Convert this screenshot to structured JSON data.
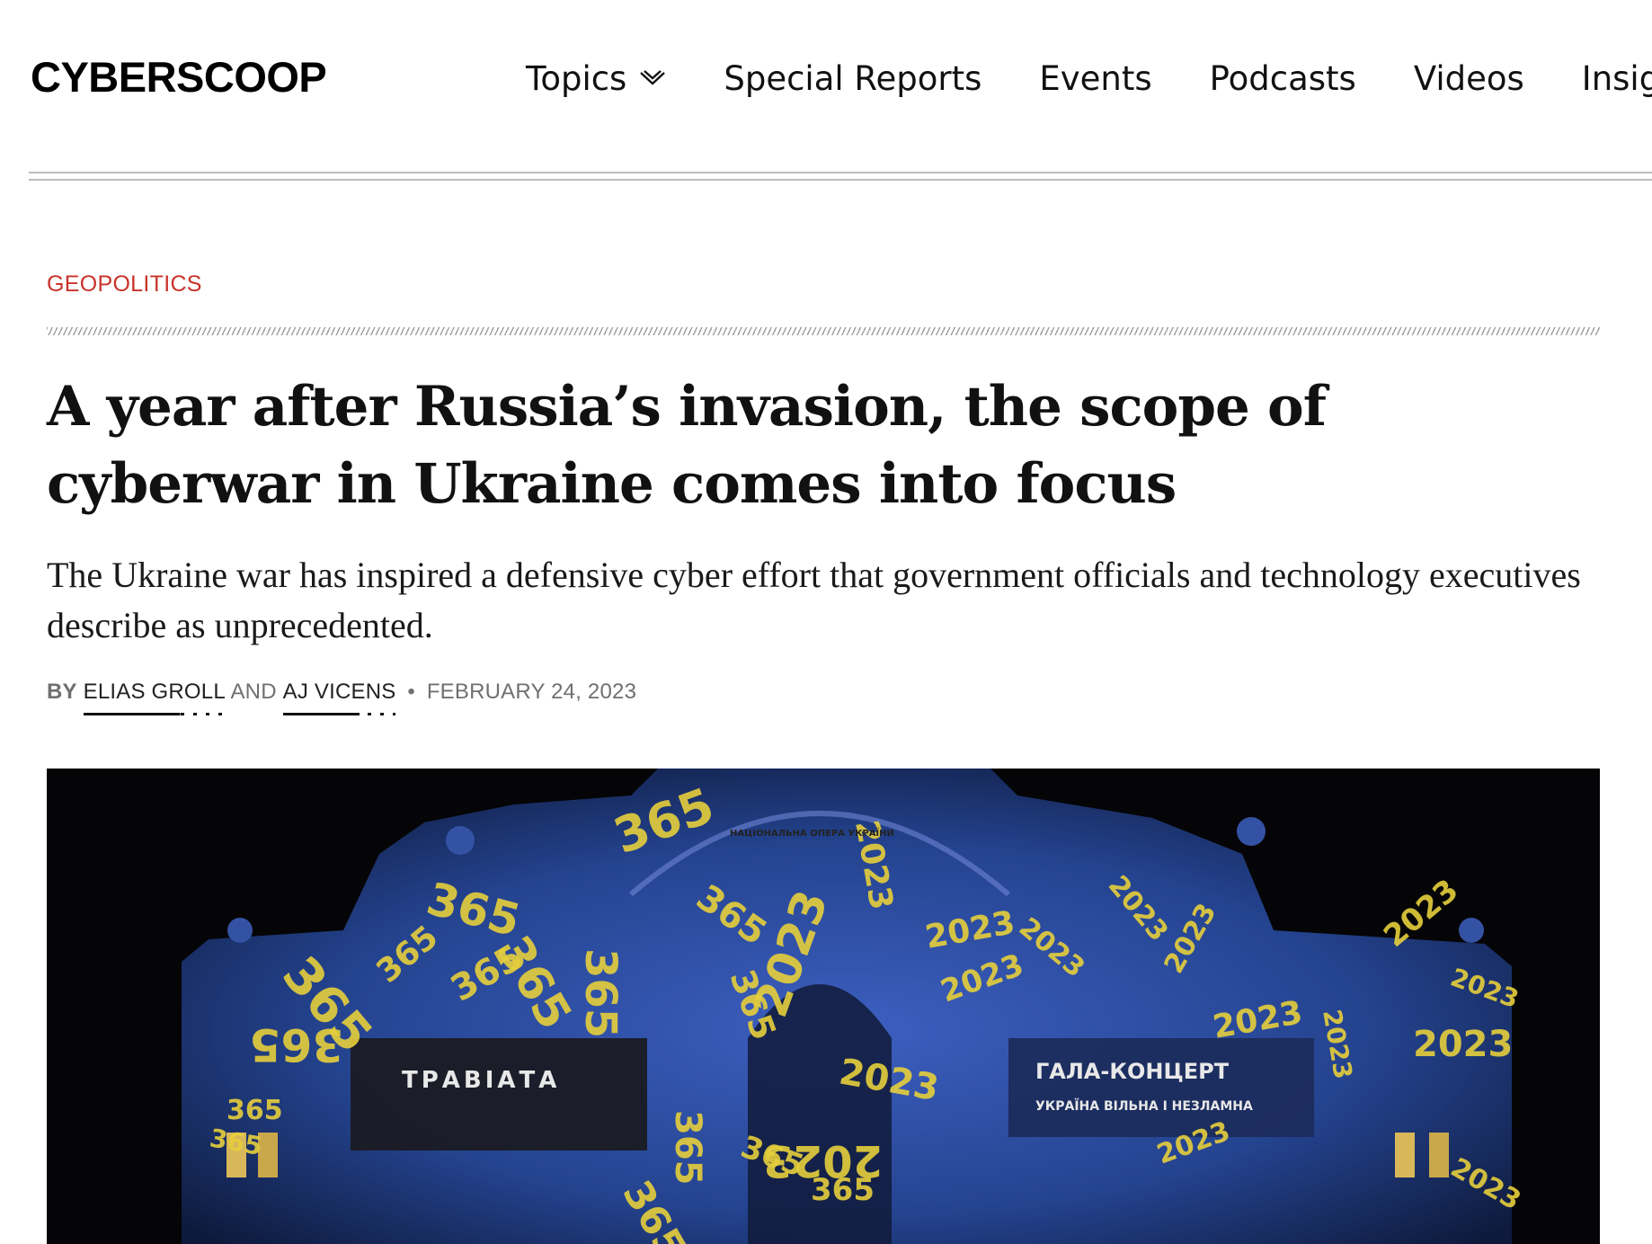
{
  "header": {
    "logo": "CYBERSCOOP",
    "nav": [
      {
        "label": "Topics",
        "has_dropdown": true
      },
      {
        "label": "Special Reports"
      },
      {
        "label": "Events"
      },
      {
        "label": "Podcasts"
      },
      {
        "label": "Videos"
      },
      {
        "label": "Insig"
      }
    ]
  },
  "article": {
    "category": "GEOPOLITICS",
    "headline": "A year after Russia’s invasion, the scope of cyberwar in Ukraine comes into focus",
    "dek": "The Ukraine war has inspired a defensive cyber effort that government officials and technology executives describe as unprecedented.",
    "byline": {
      "by": "BY",
      "author1": "ELIAS GROLL",
      "and": "AND",
      "author2": "AJ VICENS",
      "separator": "•",
      "date": "FEBRUARY 24, 2023"
    },
    "hero_image": {
      "projected_numbers": [
        "365",
        "2023"
      ],
      "signs": [
        "ТРАВІАТА",
        "ГАЛА-КОНЦЕРТ",
        "УКРАЇНА ВІЛЬНА І НЕЗЛАМНА",
        "НАЦІОНАЛЬНА ОПЕРА УКРАЇНИ"
      ]
    }
  },
  "colors": {
    "category": "#c8332a",
    "projection_blue": "#2b4fa8",
    "projection_yellow": "#e6cf3c"
  }
}
